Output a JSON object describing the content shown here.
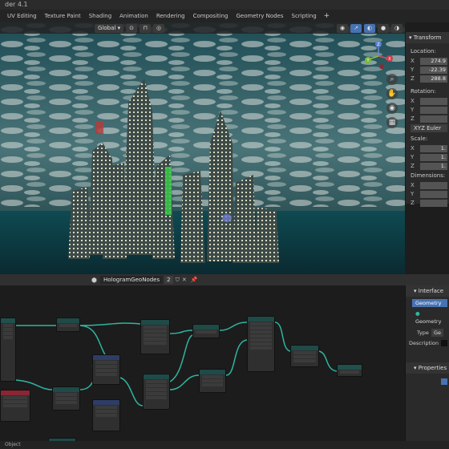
{
  "window": {
    "title": "der 4.1"
  },
  "workspace_tabs": [
    "UV Editing",
    "Texture Paint",
    "Shading",
    "Animation",
    "Rendering",
    "Compositing",
    "Geometry Nodes",
    "Scripting"
  ],
  "tab_add": "+",
  "viewport": {
    "orientation": "Global",
    "transform_panel": {
      "tab": "Transform",
      "location_label": "Location:",
      "location": {
        "x": "274.9",
        "y": "-22.39",
        "z": "288.8"
      },
      "rotation_label": "Rotation:",
      "rotation_mode": "XYZ Euler",
      "scale_label": "Scale:",
      "scale": {
        "x": "1.",
        "y": "1.",
        "z": "1."
      },
      "dimensions_label": "Dimensions:",
      "axis_labels": [
        "X",
        "Y",
        "Z"
      ]
    },
    "gizmo_axes": [
      "Z",
      "X",
      "Y"
    ]
  },
  "node_editor": {
    "tree_name": "HologramGeoNodes",
    "user_count": "2",
    "status": "Object"
  },
  "node_sidebar": {
    "interface_title": "Interface",
    "sockets": [
      "Geometry",
      "Geometry"
    ],
    "type_label": "Type",
    "type_value": "Ge",
    "description_label": "Description",
    "properties_title": "Properties"
  },
  "colors": {
    "accent": "#4772b3",
    "node_header_geometry": "#1e4a48",
    "node_header_input": "#8a2533",
    "link": "#2fb5a0"
  }
}
